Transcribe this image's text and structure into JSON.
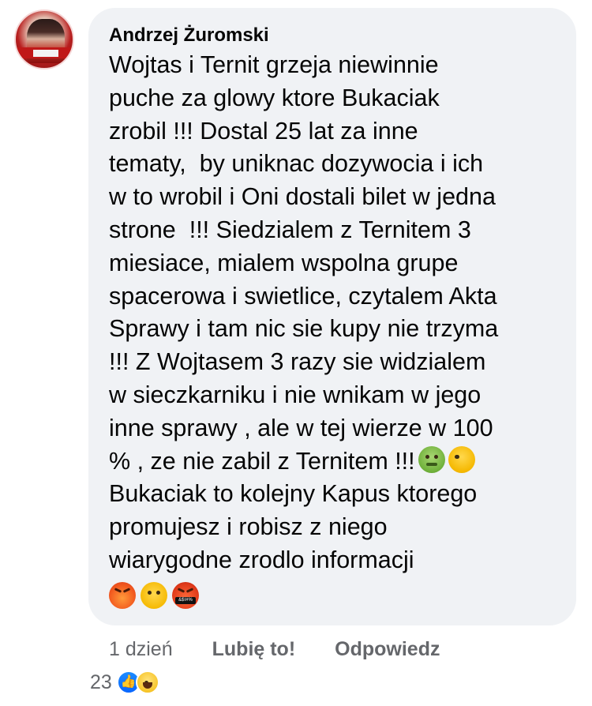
{
  "comment": {
    "author": "Andrzej Żuromski",
    "lines": [
      "Wojtas i Ternit grzeja niewinnie",
      "puche za glowy ktore Bukaciak",
      "zrobil !!! Dostal 25 lat za inne",
      "tematy,  by uniknac dozywocia i ich",
      "w to wrobil i Oni dostali bilet w jedna",
      "strone  !!! Siedzialem z Ternitem 3",
      "miesiace, mialem wspolna grupe",
      "spacerowa i swietlice, czytalem Akta",
      "Sprawy i tam nic sie kupy nie trzyma",
      "!!! Z Wojtasem 3 razy sie widzialem",
      "w sieczkarniku i nie wnikam w jego",
      "inne sprawy , ale w tej wierze w 100",
      "% , ze nie zabil z Ternitem !!!",
      "Bukaciak to kolejny Kapus ktorego",
      "promujesz i robisz z niego",
      "wiarygodne zrodlo informacji"
    ],
    "inline_emojis": [
      "nauseated-face-icon",
      "face-vomiting-icon"
    ],
    "trailing_emojis": [
      "pouting-face-icon",
      "face-with-steam-icon",
      "face-with-symbols-icon"
    ],
    "curse_symbols": "&$!#%"
  },
  "actions": {
    "time": "1 dzień",
    "like_label": "Lubię to!",
    "reply_label": "Odpowiedz"
  },
  "reactions": {
    "count": "23",
    "types": [
      "like-reaction-icon",
      "haha-reaction-icon"
    ]
  },
  "colors": {
    "bubble": "#f0f2f5",
    "secondary_text": "#65676b",
    "like_blue": "#0866ff"
  }
}
